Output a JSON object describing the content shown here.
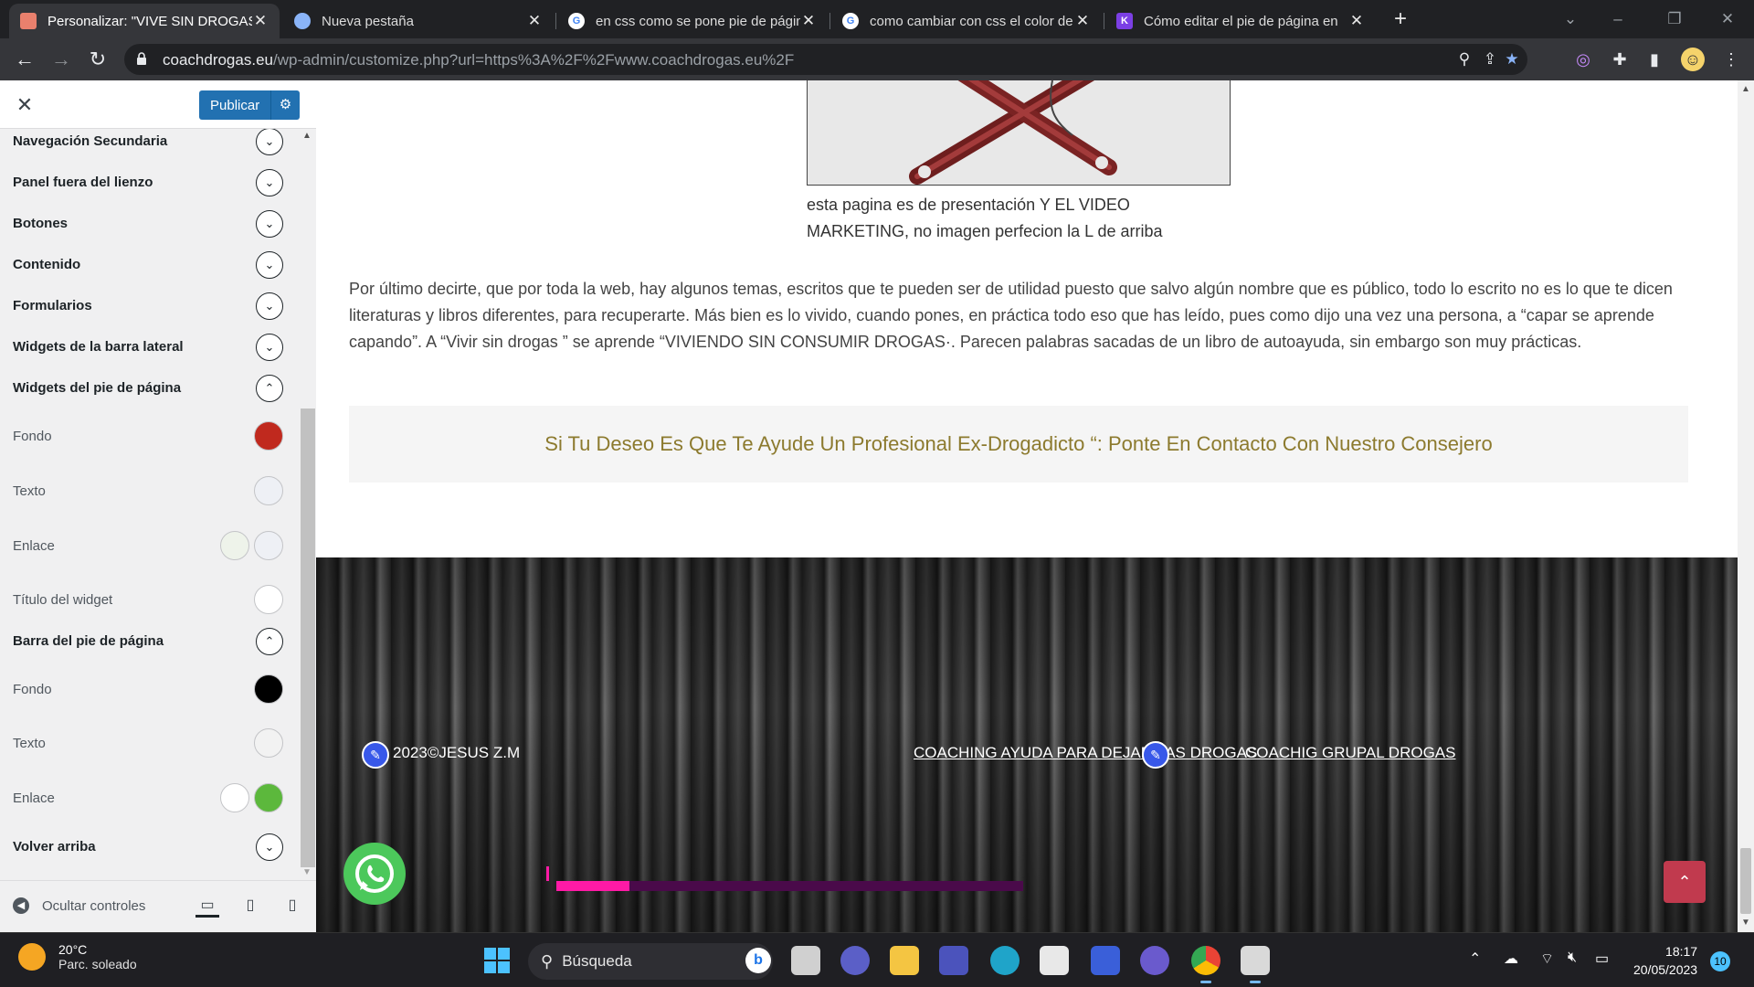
{
  "browser": {
    "tabs": [
      {
        "title": "Personalizar: \"VIVE SIN DROGAS\"",
        "active": true
      },
      {
        "title": "Nueva pestaña",
        "active": false
      },
      {
        "title": "en css como se pone pie de página",
        "active": false
      },
      {
        "title": "como cambiar con css el color de",
        "active": false
      },
      {
        "title": "Cómo editar el pie de página en",
        "active": false
      }
    ],
    "url_host": "coachdrogas.eu",
    "url_path": "/wp-admin/customize.php?url=https%3A%2F%2Fwww.coachdrogas.eu%2F"
  },
  "sidebar": {
    "publish_label": "Publicar",
    "sections": [
      {
        "label": "Navegación Secundaria"
      },
      {
        "label": "Panel fuera del lienzo"
      },
      {
        "label": "Botones"
      },
      {
        "label": "Contenido"
      },
      {
        "label": "Formularios"
      },
      {
        "label": "Widgets de la barra lateral"
      },
      {
        "label": "Widgets del pie de página"
      }
    ],
    "footer_widgets_options": [
      {
        "label": "Fondo",
        "colors": [
          "#c0291e"
        ]
      },
      {
        "label": "Texto",
        "colors": [
          "#eef0f5"
        ]
      },
      {
        "label": "Enlace",
        "colors": [
          "#eef3ea",
          "#eef0f5"
        ]
      },
      {
        "label": "Título del widget",
        "colors": [
          "#ffffff"
        ]
      }
    ],
    "footer_bar_label": "Barra del pie de página",
    "footer_bar_options": [
      {
        "label": "Fondo",
        "colors": [
          "#000000"
        ]
      },
      {
        "label": "Texto",
        "colors": [
          "#f2f2f2"
        ]
      },
      {
        "label": "Enlace",
        "colors": [
          "#ffffff",
          "#5cb83c"
        ]
      }
    ],
    "back_to_top_label": "Volver arriba",
    "hide_controls_label": "Ocultar controles"
  },
  "preview": {
    "caption_line1": "esta pagina es de presentación Y EL VIDEO",
    "caption_line2": "MARKETING, no imagen perfecion la L de arriba",
    "paragraph": "Por último decirte, que por toda la web, hay algunos temas, escritos que te pueden ser de utilidad puesto que salvo algún nombre que es público, todo lo escrito no es lo que te dicen literaturas y libros diferentes, para recuperarte. Más bien es lo vivido, cuando pones, en práctica todo eso que has leído, pues como dijo una vez una persona, a “capar se aprende capando”. A “Vivir sin drogas ” se aprende “VIVIENDO SIN CONSUMIR DROGAS·. Parecen palabras sacadas de un libro de autoayuda, sin embargo son muy prácticas.",
    "cta_text": "Si Tu Deseo Es Que Te Ayude Un Profesional Ex-Drogadicto “: Ponte En Contacto Con Nuestro Consejero",
    "copyright": "2023©JESUS Z.M",
    "footer_links": [
      "COACHING AYUDA PARA DEJAR LAS DROGAS",
      "COACHIG GRUPAL DROGAS"
    ]
  },
  "taskbar": {
    "temperature": "20°C",
    "weather": "Parc. soleado",
    "search_placeholder": "Búsqueda",
    "time": "18:17",
    "date": "20/05/2023",
    "notifications": "10"
  }
}
